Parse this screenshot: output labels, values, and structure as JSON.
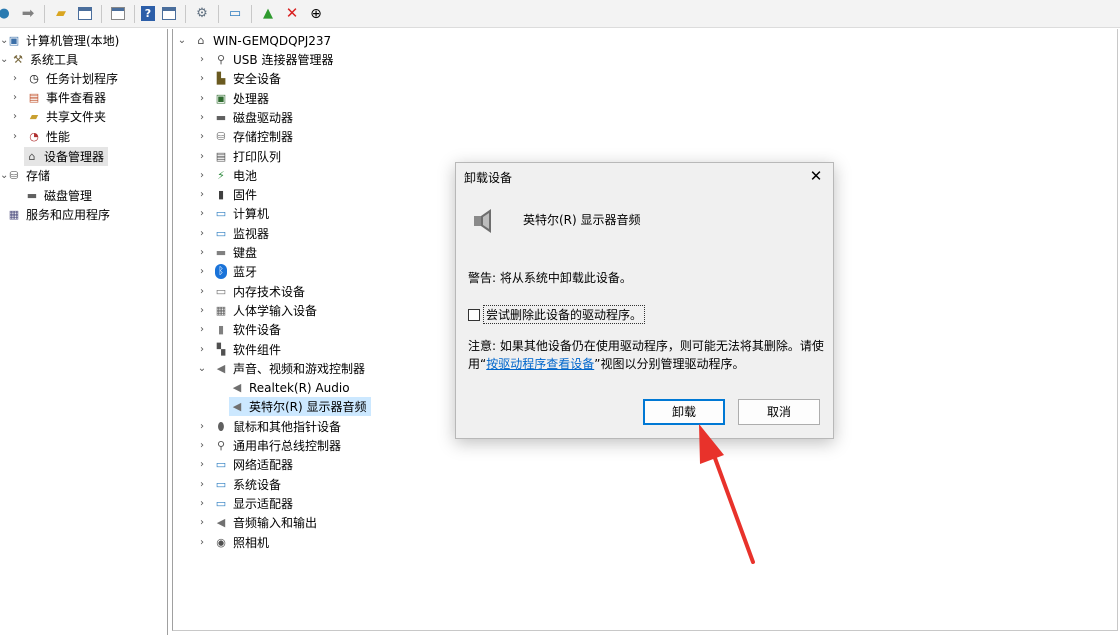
{
  "toolbar": {
    "icons": [
      "back-arrow-icon",
      "forward-arrow-icon",
      "up-folder-icon",
      "show-hide-tree-icon",
      "properties-icon",
      "help-icon",
      "view-icon",
      "scan-hardware-icon",
      "monitor-icon",
      "update-driver-icon",
      "uninstall-icon",
      "disable-device-icon"
    ]
  },
  "left_tree": {
    "root": "计算机管理(本地)",
    "system_tools": "系统工具",
    "task_scheduler": "任务计划程序",
    "event_viewer": "事件查看器",
    "shared_folders": "共享文件夹",
    "performance": "性能",
    "device_manager": "设备管理器",
    "storage": "存储",
    "disk_management": "磁盘管理",
    "services_apps": "服务和应用程序"
  },
  "device_tree": {
    "computer_name": "WIN-GEMQDQPJ237",
    "categories": [
      "USB 连接器管理器",
      "安全设备",
      "处理器",
      "磁盘驱动器",
      "存储控制器",
      "打印队列",
      "电池",
      "固件",
      "计算机",
      "监视器",
      "键盘",
      "蓝牙",
      "内存技术设备",
      "人体学输入设备",
      "软件设备",
      "软件组件",
      "声音、视频和游戏控制器"
    ],
    "audio_children": [
      "Realtek(R) Audio",
      "英特尔(R) 显示器音频"
    ],
    "categories_after": [
      "鼠标和其他指针设备",
      "通用串行总线控制器",
      "网络适配器",
      "系统设备",
      "显示适配器",
      "音频输入和输出",
      "照相机"
    ]
  },
  "dialog": {
    "title": "卸载设备",
    "device_name": "英特尔(R) 显示器音频",
    "warning": "警告: 将从系统中卸载此设备。",
    "checkbox_label": "尝试删除此设备的驱动程序。",
    "checkbox_checked": false,
    "note_line1": "注意: 如果其他设备仍在使用驱动程序，则可能无法将其删除。请使",
    "note_prefix": "用“",
    "note_link": "按驱动程序查看设备",
    "note_suffix": "”视图以分别管理驱动程序。",
    "uninstall_button": "卸载",
    "cancel_button": "取消"
  },
  "colors": {
    "selection_blue": "#cce8ff",
    "link_blue": "#0066cc",
    "arrow_red": "#e8322b",
    "primary_border": "#0078d4"
  }
}
